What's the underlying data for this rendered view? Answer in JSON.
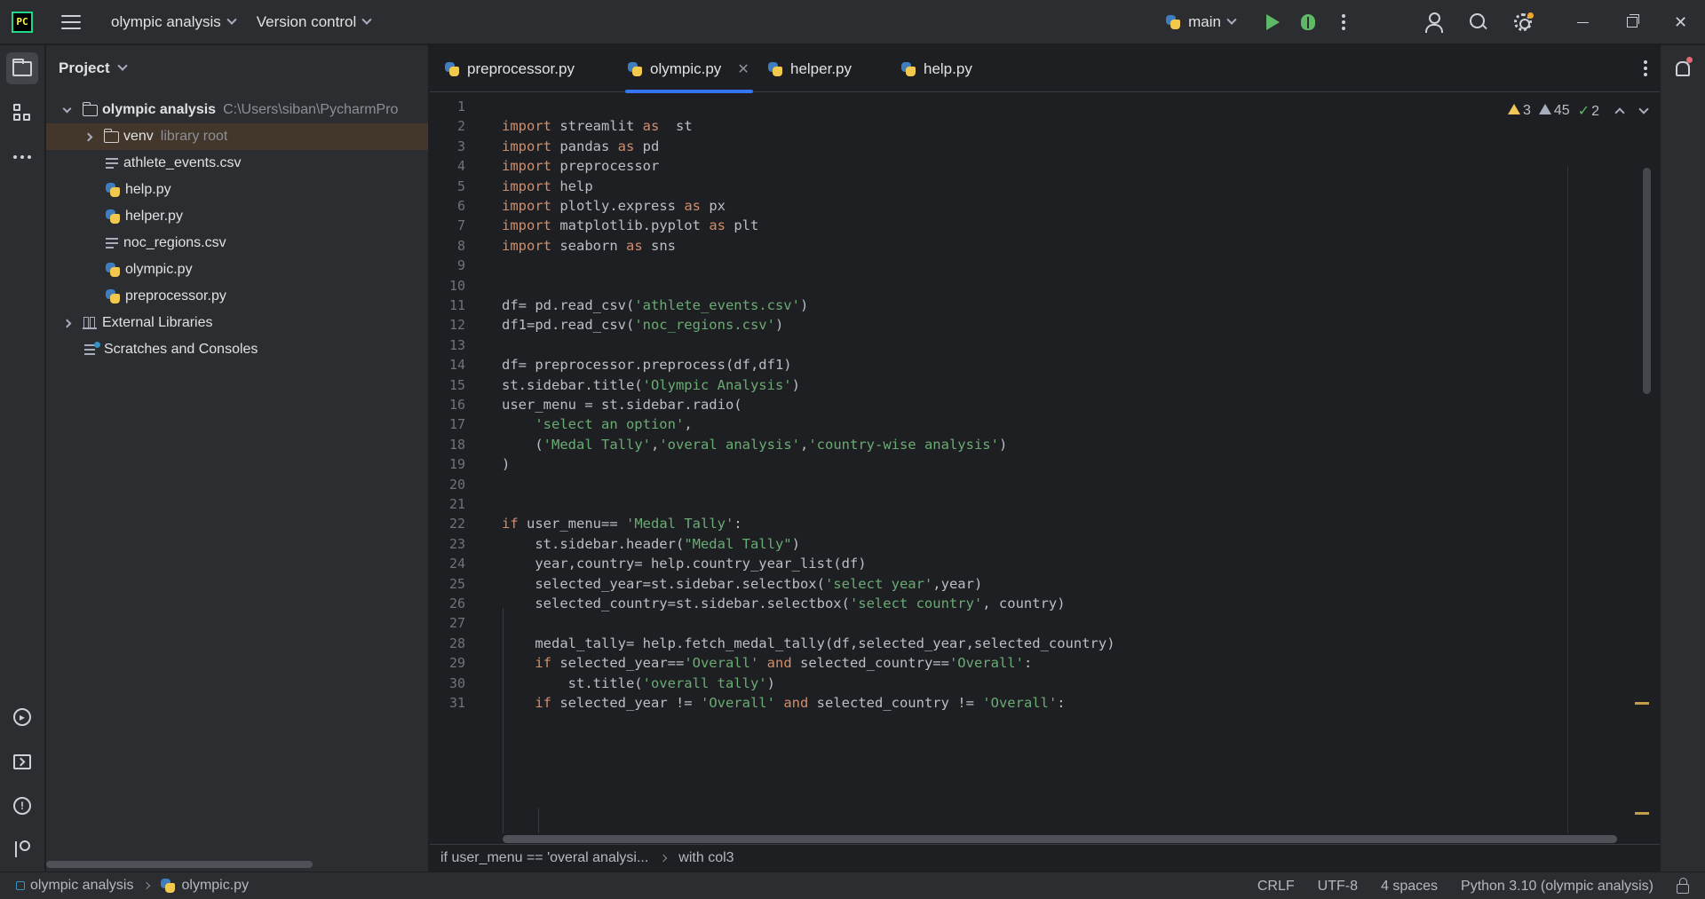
{
  "titlebar": {
    "logo_text": "PC",
    "project_name": "olympic analysis",
    "vcs_label": "Version control",
    "run_config": "main",
    "icons": [
      "hamburger-icon",
      "python-icon",
      "run-icon",
      "debug-icon",
      "more-icon",
      "user-icon",
      "search-icon",
      "gear-icon",
      "minimize-icon",
      "restore-icon",
      "close-icon"
    ]
  },
  "project_panel": {
    "title": "Project",
    "root": {
      "name": "olympic analysis",
      "path": "C:\\Users\\siban\\PycharmPro"
    },
    "items": [
      {
        "label": "venv",
        "note": "library root",
        "type": "folder"
      },
      {
        "label": "athlete_events.csv",
        "type": "text"
      },
      {
        "label": "help.py",
        "type": "python"
      },
      {
        "label": "helper.py",
        "type": "python"
      },
      {
        "label": "noc_regions.csv",
        "type": "text"
      },
      {
        "label": "olympic.py",
        "type": "python"
      },
      {
        "label": "preprocessor.py",
        "type": "python"
      }
    ],
    "external": "External Libraries",
    "scratches": "Scratches and Consoles"
  },
  "tabs": [
    {
      "label": "preprocessor.py",
      "active": false
    },
    {
      "label": "olympic.py",
      "active": true
    },
    {
      "label": "helper.py",
      "active": false
    },
    {
      "label": "help.py",
      "active": false
    }
  ],
  "inspections": {
    "warnings": "3",
    "weak_warnings": "45",
    "ok": "2"
  },
  "code_lines": [
    [],
    [
      [
        "kw",
        "import"
      ],
      [
        "t",
        " streamlit "
      ],
      [
        "kw",
        "as"
      ],
      [
        "t",
        "  st"
      ]
    ],
    [
      [
        "kw",
        "import"
      ],
      [
        "t",
        " pandas "
      ],
      [
        "kw",
        "as"
      ],
      [
        "t",
        " pd"
      ]
    ],
    [
      [
        "kw",
        "import"
      ],
      [
        "t",
        " preprocessor"
      ]
    ],
    [
      [
        "kw",
        "import"
      ],
      [
        "t",
        " help"
      ]
    ],
    [
      [
        "kw",
        "import"
      ],
      [
        "t",
        " plotly.express "
      ],
      [
        "kw",
        "as"
      ],
      [
        "t",
        " px"
      ]
    ],
    [
      [
        "kw",
        "import"
      ],
      [
        "t",
        " matplotlib.pyplot "
      ],
      [
        "kw",
        "as"
      ],
      [
        "t",
        " plt"
      ]
    ],
    [
      [
        "kw",
        "import"
      ],
      [
        "t",
        " seaborn "
      ],
      [
        "kw",
        "as"
      ],
      [
        "t",
        " sns"
      ]
    ],
    [],
    [],
    [
      [
        "t",
        "df= pd.read_csv("
      ],
      [
        "str",
        "'athlete_events.csv'"
      ],
      [
        "t",
        ")"
      ]
    ],
    [
      [
        "t",
        "df1=pd.read_csv("
      ],
      [
        "str",
        "'noc_regions.csv'"
      ],
      [
        "t",
        ")"
      ]
    ],
    [],
    [
      [
        "t",
        "df= preprocessor.preprocess(df,df1)"
      ]
    ],
    [
      [
        "t",
        "st.sidebar.title("
      ],
      [
        "str",
        "'Olympic Analysis'"
      ],
      [
        "t",
        ")"
      ]
    ],
    [
      [
        "t",
        "user_menu = st.sidebar.radio("
      ]
    ],
    [
      [
        "t",
        "    "
      ],
      [
        "str",
        "'select an option'"
      ],
      [
        "t",
        ","
      ]
    ],
    [
      [
        "t",
        "    ("
      ],
      [
        "str",
        "'Medal Tally'"
      ],
      [
        "t",
        ","
      ],
      [
        "str",
        "'overal analysis'"
      ],
      [
        "t",
        ","
      ],
      [
        "str",
        "'country-wise analysis'"
      ],
      [
        "t",
        ")"
      ]
    ],
    [
      [
        "t",
        ")"
      ]
    ],
    [],
    [],
    [
      [
        "kw",
        "if"
      ],
      [
        "t",
        " user_menu== "
      ],
      [
        "str",
        "'Medal Tally'"
      ],
      [
        "t",
        ":"
      ]
    ],
    [
      [
        "t",
        "    st.sidebar.header("
      ],
      [
        "str",
        "\"Medal Tally\""
      ],
      [
        "t",
        ")"
      ]
    ],
    [
      [
        "t",
        "    year,country= help.country_year_list(df)"
      ]
    ],
    [
      [
        "t",
        "    selected_year=st.sidebar.selectbox("
      ],
      [
        "str",
        "'select year'"
      ],
      [
        "t",
        ",year)"
      ]
    ],
    [
      [
        "t",
        "    selected_country=st.sidebar.selectbox("
      ],
      [
        "str",
        "'select country'"
      ],
      [
        "t",
        ", country)"
      ]
    ],
    [],
    [
      [
        "t",
        "    medal_tally= help.fetch_medal_tally(df,selected_year,selected_country)"
      ]
    ],
    [
      [
        "t",
        "    "
      ],
      [
        "kw",
        "if"
      ],
      [
        "t",
        " selected_year=="
      ],
      [
        "str",
        "'Overall'"
      ],
      [
        "t",
        " "
      ],
      [
        "kw",
        "and"
      ],
      [
        "t",
        " selected_country=="
      ],
      [
        "str",
        "'Overall'"
      ],
      [
        "t",
        ":"
      ]
    ],
    [
      [
        "t",
        "        st.title("
      ],
      [
        "str",
        "'overall tally'"
      ],
      [
        "t",
        ")"
      ]
    ],
    [
      [
        "t",
        "    "
      ],
      [
        "kw",
        "if"
      ],
      [
        "t",
        " selected_year != "
      ],
      [
        "str",
        "'Overall'"
      ],
      [
        "t",
        " "
      ],
      [
        "kw",
        "and"
      ],
      [
        "t",
        " selected_country != "
      ],
      [
        "str",
        "'Overall'"
      ],
      [
        "t",
        ":"
      ]
    ]
  ],
  "breadcrumbs": [
    "if user_menu == 'overal analysi...",
    "with col3"
  ],
  "statusbar": {
    "path": [
      "olympic analysis",
      "olympic.py"
    ],
    "line_sep": "CRLF",
    "encoding": "UTF-8",
    "indent": "4 spaces",
    "interpreter": "Python 3.10 (olympic analysis)"
  }
}
